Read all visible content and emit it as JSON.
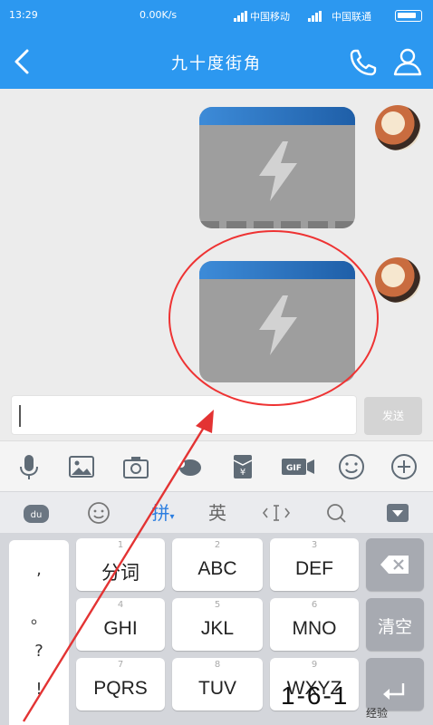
{
  "status_bar": {
    "time": "13:29",
    "network_speed": "0.00K/s",
    "carrier_1": "中国移动",
    "carrier_2": "中国联通"
  },
  "header": {
    "title": "九十度街角"
  },
  "input": {
    "send_label": "发送",
    "value": ""
  },
  "ime_bar": {
    "pinyin_label": "拼",
    "english_label": "英"
  },
  "keyboard": {
    "punctuation": [
      ",",
      "。",
      "?",
      "!"
    ],
    "rows": [
      [
        {
          "num": "1",
          "label": "分词"
        },
        {
          "num": "2",
          "label": "ABC"
        },
        {
          "num": "3",
          "label": "DEF"
        }
      ],
      [
        {
          "num": "4",
          "label": "GHI"
        },
        {
          "num": "5",
          "label": "JKL"
        },
        {
          "num": "6",
          "label": "MNO"
        }
      ],
      [
        {
          "num": "7",
          "label": "PQRS"
        },
        {
          "num": "8",
          "label": "TUV"
        },
        {
          "num": "9",
          "label": "WXYZ"
        }
      ]
    ],
    "clear_label": "清空"
  },
  "overlay": {
    "watermark_text": "1-6-1",
    "watermark_small": "经验"
  },
  "colors": {
    "header_blue": "#2c98f0",
    "annotation_red": "#e33333"
  }
}
